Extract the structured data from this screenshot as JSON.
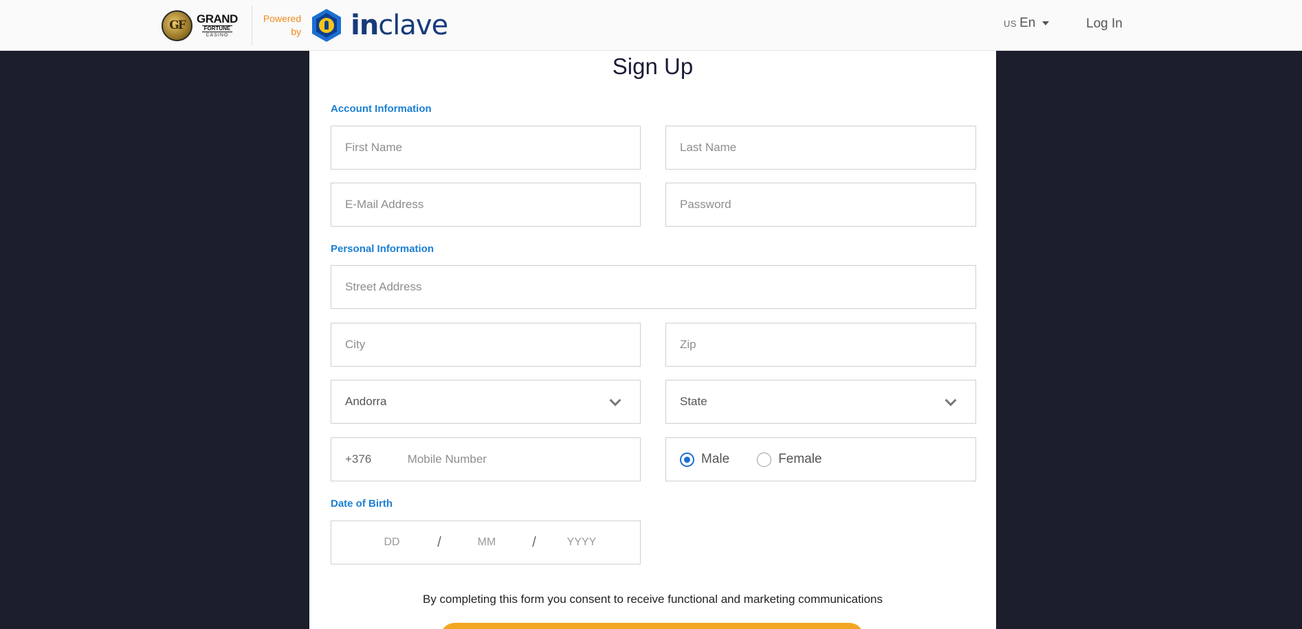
{
  "header": {
    "brand": {
      "logo_monogram": "GF",
      "logo_line1": "GRAND",
      "logo_line2": "FORTUNE",
      "logo_line3": "CASINO",
      "powered_line1": "Powered",
      "powered_line2": "by",
      "partner_prefix": "in",
      "partner_suffix": "clave"
    },
    "language": {
      "flag": "US",
      "label": "En"
    },
    "login_label": "Log In"
  },
  "form": {
    "title": "Sign Up",
    "account_section": "Account Information",
    "first_name": {
      "placeholder": "First Name",
      "value": ""
    },
    "last_name": {
      "placeholder": "Last Name",
      "value": ""
    },
    "email": {
      "placeholder": "E-Mail Address",
      "value": ""
    },
    "password": {
      "placeholder": "Password",
      "value": ""
    },
    "personal_section": "Personal Information",
    "street": {
      "placeholder": "Street Address",
      "value": ""
    },
    "city": {
      "placeholder": "City",
      "value": ""
    },
    "zip": {
      "placeholder": "Zip",
      "value": ""
    },
    "country": {
      "selected": "Andorra"
    },
    "state": {
      "selected": "State"
    },
    "phone": {
      "prefix": "+376",
      "placeholder": "Mobile Number",
      "value": ""
    },
    "gender": {
      "options": [
        {
          "label": "Male",
          "checked": true
        },
        {
          "label": "Female",
          "checked": false
        }
      ]
    },
    "dob_section": "Date of Birth",
    "dob": {
      "day_placeholder": "DD",
      "month_placeholder": "MM",
      "year_placeholder": "YYYY",
      "separator": "/"
    },
    "consent_text": "By completing this form you consent to receive functional and marketing communications"
  },
  "colors": {
    "page_bg": "#1c1e2c",
    "header_bg": "#fafafa",
    "section_label": "#1a7fd4",
    "powered_by": "#f08a1c",
    "radio_accent": "#1a6fcf",
    "submit_button": "#f4a623"
  }
}
